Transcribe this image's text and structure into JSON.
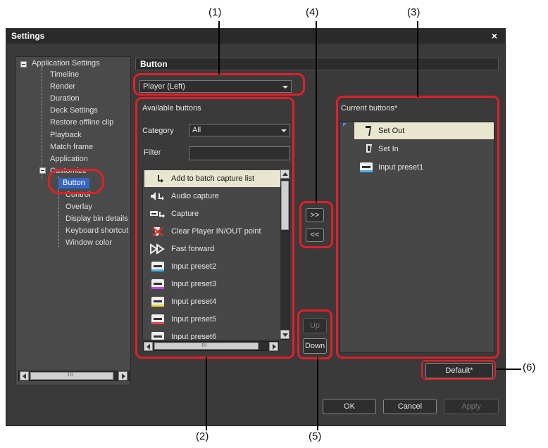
{
  "callouts": {
    "c1": "(1)",
    "c2": "(2)",
    "c3": "(3)",
    "c4": "(4)",
    "c5": "(5)",
    "c6": "(6)"
  },
  "window": {
    "title": "Settings",
    "close": "×"
  },
  "tree": {
    "root": "Application Settings",
    "children": [
      "Timeline",
      "Render",
      "Duration",
      "Deck Settings",
      "Restore offline clip",
      "Playback",
      "Match frame",
      "Application"
    ],
    "group": "Customize",
    "group_children": [
      "Button",
      "Control",
      "Overlay",
      "Display bin details",
      "Keyboard shortcut",
      "Window color"
    ],
    "scroll_mark": "III"
  },
  "main": {
    "header": "Button",
    "player_select": "Player (Left)"
  },
  "available": {
    "title": "Available buttons",
    "category_label": "Category",
    "category_value": "All",
    "filter_label": "Filter",
    "filter_value": "",
    "items": [
      "Add to batch capture list",
      "Audio capture",
      "Capture",
      "Clear Player IN/OUT point",
      "Fast forward",
      "Input preset2",
      "Input preset3",
      "Input preset4",
      "Input preset5",
      "Input preset6"
    ],
    "scroll_mark": "III"
  },
  "current": {
    "title": "Current buttons*",
    "items": [
      "Set Out",
      "Set In",
      "Input preset1"
    ]
  },
  "buttons": {
    "add": ">>",
    "remove": "<<",
    "up": "Up",
    "down": "Down",
    "default": "Default*",
    "ok": "OK",
    "cancel": "Cancel",
    "apply": "Apply"
  },
  "colors": {
    "highlight": "#e0202a",
    "selection": "#e8e6cf",
    "tree_selected": "#3566c7"
  }
}
